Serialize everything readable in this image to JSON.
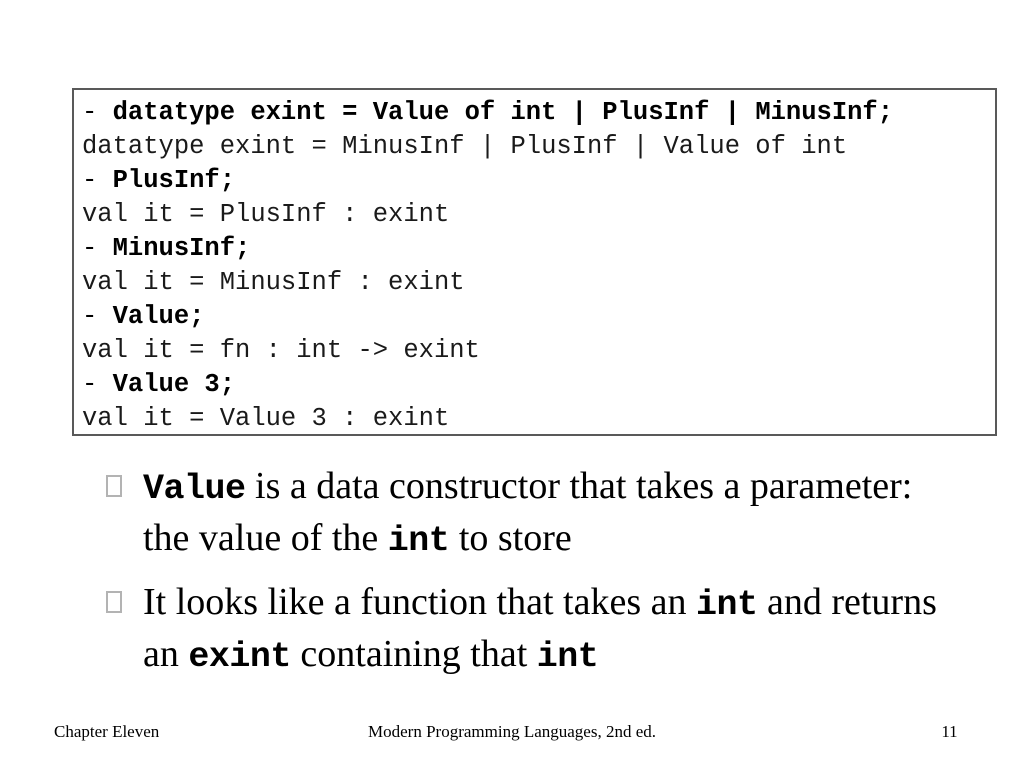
{
  "slide": {
    "page_number": "11"
  },
  "code_box": {
    "lines": [
      {
        "kind": "prompt",
        "marker": "- ",
        "text": "datatype exint = Value of int | PlusInf | MinusInf;"
      },
      {
        "kind": "output",
        "marker": "",
        "text": "datatype exint = MinusInf | PlusInf | Value of int"
      },
      {
        "kind": "prompt",
        "marker": "- ",
        "text": "PlusInf;"
      },
      {
        "kind": "output",
        "marker": "",
        "text": "val it = PlusInf : exint"
      },
      {
        "kind": "prompt",
        "marker": "- ",
        "text": "MinusInf;"
      },
      {
        "kind": "output",
        "marker": "",
        "text": "val it = MinusInf : exint"
      },
      {
        "kind": "prompt",
        "marker": "- ",
        "text": "Value;"
      },
      {
        "kind": "output",
        "marker": "",
        "text": "val it = fn : int -> exint"
      },
      {
        "kind": "prompt",
        "marker": "- ",
        "text": "Value 3;"
      },
      {
        "kind": "output",
        "marker": "",
        "text": "val it = Value 3 : exint"
      }
    ]
  },
  "bullets": {
    "glyph_name": "missing-glyph-box-bullet",
    "items": [
      {
        "runs": [
          {
            "style": "mono",
            "text": "Value"
          },
          {
            "style": "serif",
            "text": " is a data constructor that takes a parameter: the value of the "
          },
          {
            "style": "mono",
            "text": "int"
          },
          {
            "style": "serif",
            "text": " to store"
          }
        ]
      },
      {
        "runs": [
          {
            "style": "serif",
            "text": "It looks like a function that takes an "
          },
          {
            "style": "mono",
            "text": "int"
          },
          {
            "style": "serif",
            "text": " and returns an "
          },
          {
            "style": "mono",
            "text": "exint"
          },
          {
            "style": "serif",
            "text": " containing that "
          },
          {
            "style": "mono",
            "text": "int"
          }
        ]
      }
    ]
  },
  "footer": {
    "left": "Chapter Eleven",
    "center": "Modern Programming Languages, 2nd ed.",
    "right": "11"
  },
  "colors": {
    "background": "#ffffff",
    "text": "#000000",
    "box_border": "#595959",
    "bullet_glyph": "#b3b3b3"
  }
}
